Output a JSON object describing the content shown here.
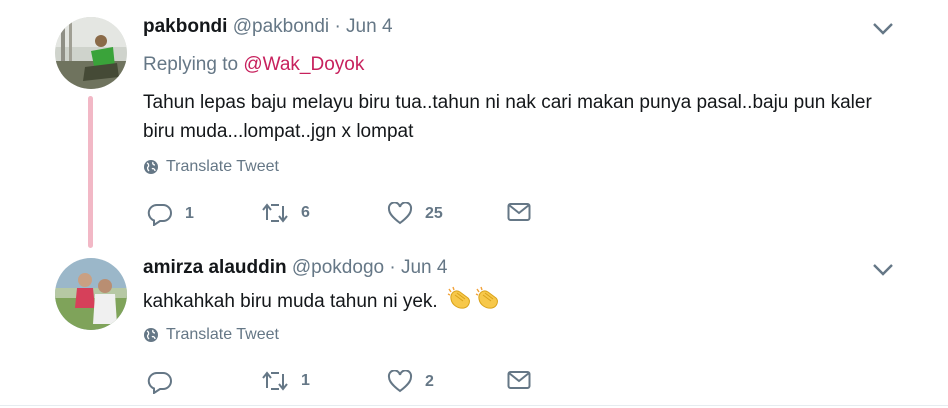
{
  "tweets": [
    {
      "name": "pakbondi",
      "handle": "@pakbondi",
      "date": "· Jun 4",
      "replying_prefix": "Replying to",
      "replying_to": "@Wak_Doyok",
      "text": "Tahun lepas baju melayu biru tua..tahun ni  nak cari makan punya pasal..baju pun kaler biru muda...lompat..jgn x lompat",
      "translate_label": "Translate Tweet",
      "replies": "1",
      "retweets": "6",
      "likes": "25"
    },
    {
      "name": "amirza alauddin",
      "handle": "@pokdogo",
      "date": "· Jun 4",
      "text": "kahkahkah biru muda tahun ni yek.",
      "emojis": [
        "clapping-hands",
        "clapping-hands"
      ],
      "translate_label": "Translate Tweet",
      "replies": "",
      "retweets": "1",
      "likes": "2"
    }
  ],
  "colors": {
    "text": "#14171a",
    "secondary": "#657786",
    "mention": "#c7215d",
    "thread_line": "#f2b8c6"
  },
  "icons": [
    "reply-icon",
    "retweet-icon",
    "like-icon",
    "direct-message-icon",
    "globe-icon",
    "chevron-down-icon"
  ]
}
